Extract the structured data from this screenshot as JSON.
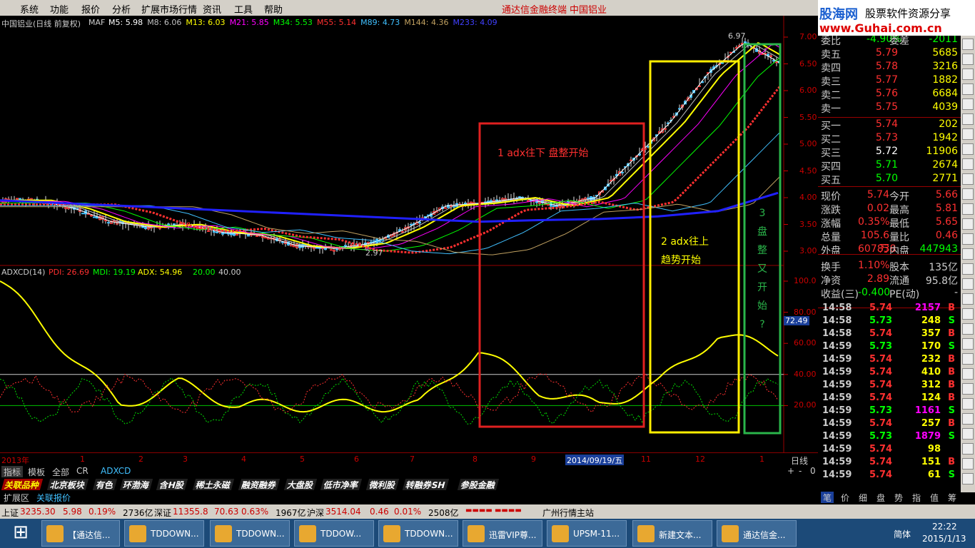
{
  "menu": [
    "系统",
    "功能",
    "报价",
    "分析",
    "扩展市场行情",
    "资讯",
    "工具",
    "帮助"
  ],
  "app_title": "通达信金融终端",
  "stock_title": "中国铝业",
  "logo": {
    "a": "股海网",
    "b": "股票软件资源分享",
    "c": "www.Guhai.com.cn"
  },
  "main": {
    "name": "中国铝业(日线 前复权)",
    "maf": "MAF",
    "ma": [
      {
        "label": "M5: 5.98",
        "color": "#ffffff"
      },
      {
        "label": "M8: 6.06",
        "color": "#c0c0c0"
      },
      {
        "label": "M13: 6.03",
        "color": "#ffff00"
      },
      {
        "label": "M21: 5.85",
        "color": "#ff00ff"
      },
      {
        "label": "M34: 5.53",
        "color": "#00ff00"
      },
      {
        "label": "M55: 5.14",
        "color": "#ff3030"
      },
      {
        "label": "M89: 4.73",
        "color": "#40c0ff"
      },
      {
        "label": "M144: 4.36",
        "color": "#c0a060"
      },
      {
        "label": "M233: 4.09",
        "color": "#4040ff"
      }
    ],
    "high_label": "6.97",
    "low_label": "2.97",
    "yticks": [
      "7.00",
      "6.50",
      "6.00",
      "5.50",
      "5.00",
      "4.50",
      "4.00",
      "3.50",
      "3.00"
    ]
  },
  "adx": {
    "name": "ADXCD(14)",
    "pdi": "PDI: 26.69",
    "mdi": "MDI: 19.19",
    "adx": "ADX: 54.96",
    "l20": "20.00",
    "l40": "40.00",
    "yticks": [
      "100.0",
      "80.00",
      "60.00",
      "40.00",
      "20.00"
    ],
    "marker": "72.49"
  },
  "annotations": {
    "a1": "1 adx往下 盘整开始",
    "a2a": "2 adx往上",
    "a2b": "趋势开始",
    "a3": [
      "3",
      "盘",
      "整",
      "又",
      "开",
      "始",
      "?"
    ]
  },
  "xaxis": {
    "labels": [
      "2013年",
      "1",
      "2",
      "3",
      "4",
      "5",
      "6",
      "7",
      "8",
      "9",
      "2014/09/19/五",
      "11",
      "12",
      "1"
    ],
    "period": "日线"
  },
  "chart_data": {
    "type": "line",
    "title": "中国铝业(日线 前复权)",
    "series": [
      {
        "name": "M233",
        "values": [
          3.95,
          3.9,
          3.85,
          3.8,
          3.75,
          3.7,
          3.65,
          3.6,
          3.55,
          3.58,
          3.6,
          3.65,
          3.75,
          4.09
        ]
      },
      {
        "name": "ADX",
        "values": [
          100,
          60,
          20,
          34,
          20,
          20,
          20,
          20,
          56,
          30,
          20,
          34,
          66,
          54.96
        ]
      }
    ]
  },
  "quote": {
    "rows": [
      [
        "委比",
        "-4.90%",
        "委差",
        "-2011"
      ],
      [
        "卖五",
        "5.79",
        "",
        "5685"
      ],
      [
        "卖四",
        "5.78",
        "",
        "3216"
      ],
      [
        "卖三",
        "5.77",
        "",
        "1882"
      ],
      [
        "卖二",
        "5.76",
        "",
        "6684"
      ],
      [
        "卖一",
        "5.75",
        "",
        "4039"
      ],
      [
        "买一",
        "5.74",
        "",
        "202"
      ],
      [
        "买二",
        "5.73",
        "",
        "1942"
      ],
      [
        "买三",
        "5.72",
        "",
        "11906"
      ],
      [
        "买四",
        "5.71",
        "",
        "2674"
      ],
      [
        "买五",
        "5.70",
        "",
        "2771"
      ],
      [
        "现价",
        "5.74",
        "今开",
        "5.66"
      ],
      [
        "涨跌",
        "0.02",
        "最高",
        "5.81"
      ],
      [
        "涨幅",
        "0.35%",
        "最低",
        "5.65"
      ],
      [
        "总量",
        "105.6万",
        "量比",
        "0.46"
      ],
      [
        "外盘",
        "607838",
        "内盘",
        "447943"
      ],
      [
        "换手",
        "1.10%",
        "股本",
        "135亿"
      ],
      [
        "净资",
        "2.89",
        "流通",
        "95.8亿"
      ],
      [
        "收益(三)",
        "-0.400",
        "PE(动)",
        "-"
      ]
    ]
  },
  "ticks": [
    [
      "14:58",
      "5.74",
      "2157",
      "B"
    ],
    [
      "14:58",
      "5.73",
      "248",
      "S"
    ],
    [
      "14:58",
      "5.74",
      "357",
      "B"
    ],
    [
      "14:59",
      "5.73",
      "170",
      "S"
    ],
    [
      "14:59",
      "5.74",
      "232",
      "B"
    ],
    [
      "14:59",
      "5.74",
      "410",
      "B"
    ],
    [
      "14:59",
      "5.74",
      "312",
      "B"
    ],
    [
      "14:59",
      "5.74",
      "124",
      "B"
    ],
    [
      "14:59",
      "5.73",
      "1161",
      "S"
    ],
    [
      "14:59",
      "5.74",
      "257",
      "B"
    ],
    [
      "14:59",
      "5.73",
      "1879",
      "S"
    ],
    [
      "14:59",
      "5.74",
      "98",
      ""
    ],
    [
      "14:59",
      "5.74",
      "151",
      "B"
    ],
    [
      "14:59",
      "5.74",
      "61",
      "S"
    ]
  ],
  "tabs1": [
    "指标",
    "模板",
    "全部",
    "CR",
    "ADXCD"
  ],
  "tabs2": [
    "关联品种",
    "北京板块",
    "有色",
    "环渤海",
    "含H股",
    "稀土永磁",
    "融资融券",
    "大盘股",
    "低市净率",
    "微利股",
    "转融券SH",
    "参股金融"
  ],
  "tabs3": [
    "扩展区",
    "关联报价"
  ],
  "rtabs": [
    "笔",
    "价",
    "细",
    "盘",
    "势",
    "指",
    "值",
    "筹"
  ],
  "status": {
    "sh": "上证",
    "shv": "3235.30",
    "shc": "5.98",
    "shp": "0.19%",
    "sha": "2736亿",
    "sz": "深证",
    "szv": "11355.8",
    "szc": "70.63",
    "szp": "0.63%",
    "sza": "1967亿",
    "hs": "沪深",
    "hsv": "3514.04",
    "hsc": "0.46",
    "hsp": "0.01%",
    "hsa": "2508亿",
    "server": "广州行情主站"
  },
  "taskbar": {
    "items": [
      "【通达信...",
      "TDDOWN...",
      "TDDOWN...",
      "TDDOW...",
      "TDDOWN...",
      "迅雷VIP尊...",
      "UPSM-11...",
      "新建文本...",
      "通达信金..."
    ],
    "ime": "简体",
    "time": "22:22",
    "date": "2015/1/13"
  }
}
